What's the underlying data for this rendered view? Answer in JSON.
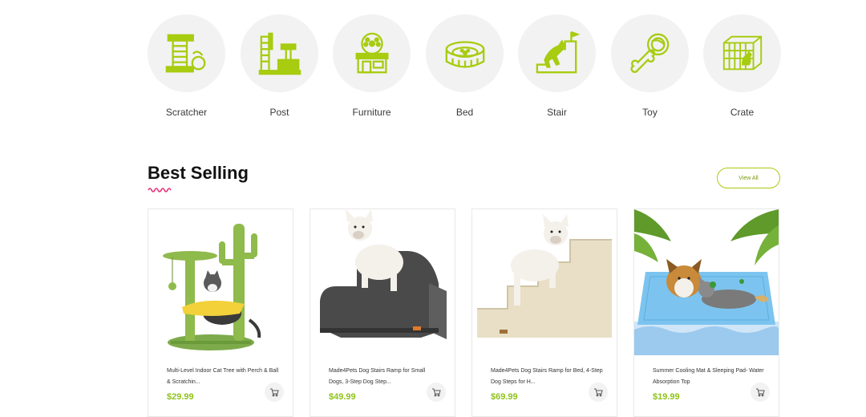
{
  "categories": [
    {
      "label": "Scratcher",
      "icon": "cat-scratcher-icon"
    },
    {
      "label": "Post",
      "icon": "cat-post-icon"
    },
    {
      "label": "Furniture",
      "icon": "pet-furniture-icon"
    },
    {
      "label": "Bed",
      "icon": "pet-bed-icon"
    },
    {
      "label": "Stair",
      "icon": "pet-stair-icon"
    },
    {
      "label": "Toy",
      "icon": "pet-toy-icon"
    },
    {
      "label": "Crate",
      "icon": "pet-crate-icon"
    }
  ],
  "section": {
    "title": "Best Selling",
    "view_all": "View All"
  },
  "products": [
    {
      "name": "Multi-Level Indoor Cat Tree with Perch & Ball & Scratchin...",
      "price": "$29.99"
    },
    {
      "name": "Made4Pets Dog Stairs Ramp for Small Dogs, 3-Step Dog Step...",
      "price": "$49.99"
    },
    {
      "name": "Made4Pets Dog Stairs Ramp for Bed, 4-Step Dog Steps for H...",
      "price": "$69.99"
    },
    {
      "name": "Summer Cooling Mat & Sleeping Pad- Water Absorption Top",
      "price": "$19.99"
    }
  ],
  "colors": {
    "accent_green": "#a7cc10",
    "price_green": "#8fc21a",
    "squiggle_pink": "#e8347a",
    "circle_bg": "#f2f2f2"
  }
}
